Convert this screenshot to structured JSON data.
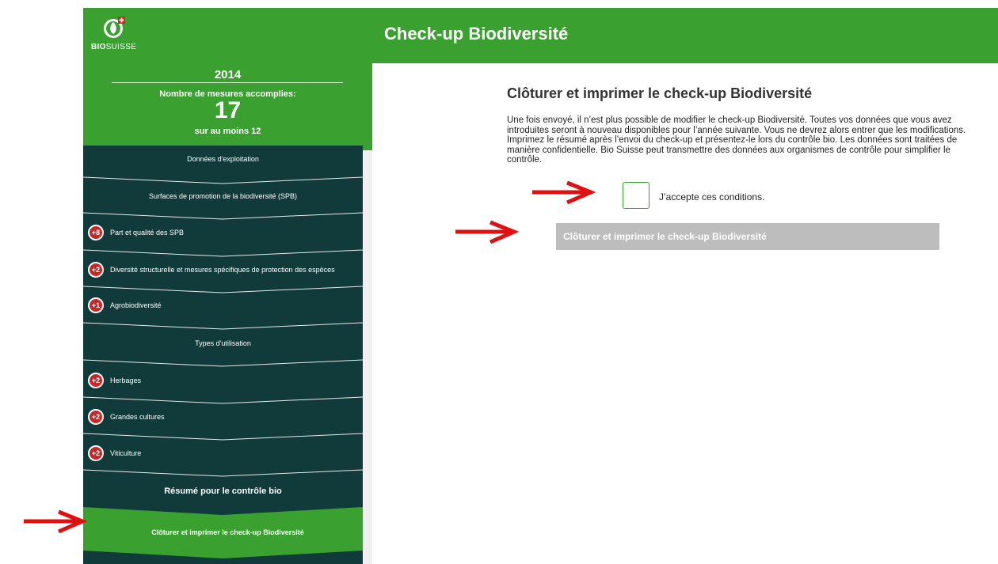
{
  "header": {
    "title": "Check-up Biodiversité",
    "logo_text_bold": "BIO",
    "logo_text": "SUISSE"
  },
  "sidebar": {
    "year": "2014",
    "measures_label": "Nombre de mesures accomplies:",
    "measures_count": "17",
    "measures_min": "sur au moins 12",
    "items": [
      {
        "label": "Données d'exploitation",
        "badge": ""
      },
      {
        "label": "Surfaces de promotion de la biodiversité (SPB)",
        "badge": ""
      },
      {
        "label": "Part et qualité des SPB",
        "badge": "+8"
      },
      {
        "label": "Diversité structurelle et mesures spécifiques de protection des espèces",
        "badge": "+2"
      },
      {
        "label": "Agrobiodiversité",
        "badge": "+1"
      },
      {
        "label": "Types d'utilisation",
        "badge": ""
      },
      {
        "label": "Herbages",
        "badge": "+2"
      },
      {
        "label": "Grandes cultures",
        "badge": "+2"
      },
      {
        "label": "Viticulture",
        "badge": "+2"
      },
      {
        "label": "Résumé pour le contrôle bio",
        "badge": ""
      }
    ],
    "active_item": "Clôturer et imprimer le check-up Biodiversité"
  },
  "main": {
    "title": "Clôturer et imprimer le check-up Biodiversité",
    "description": "Une fois envoyé, il n’est plus possible de modifier le check-up Biodiversité. Toutes vos données que vous avez introduites seront à nouveau disponibles pour l’année suivante. Vous ne devrez alors entrer que les modifications. Imprimez le résumé après l’envoi du check-up et présentez-le lors du contrôle bio. Les données sont traitées de manière confidentielle. Bio Suisse peut transmettre des données aux organismes de contrôle pour simplifier le contrôle.",
    "accept_label": "J’accepte ces conditions.",
    "accept_checked": false,
    "submit_label": "Clôturer et imprimer le check-up Biodiversité"
  },
  "colors": {
    "brand_green": "#3aa02f",
    "sidebar_dark": "#113b3b",
    "badge_red": "#c42828",
    "disabled_gray": "#bdbdbd",
    "annotation_red": "#e01010"
  }
}
